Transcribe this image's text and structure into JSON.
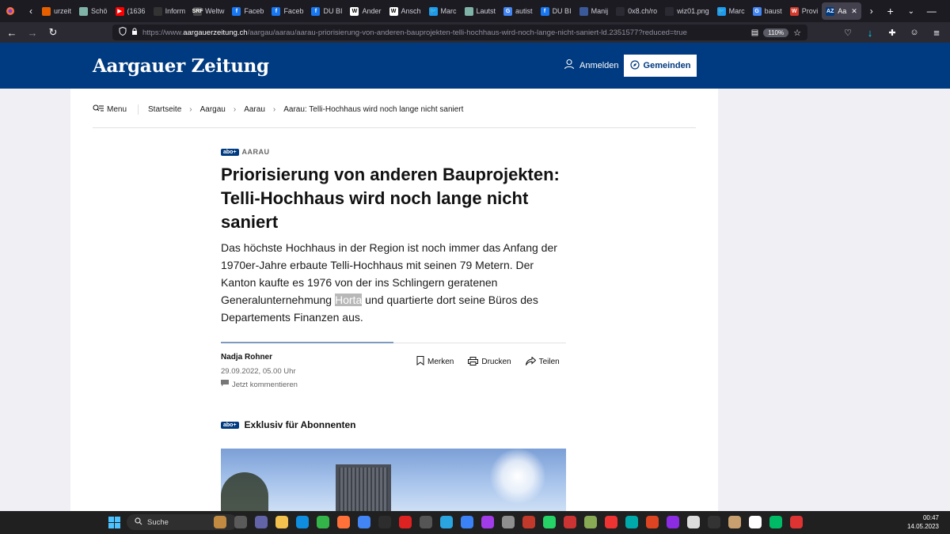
{
  "browser": {
    "tabs": [
      {
        "label": "urzeit",
        "color": "#e66000",
        "favtext": ""
      },
      {
        "label": "Schö",
        "color": "#7fb3a7",
        "favtext": ""
      },
      {
        "label": "(1636",
        "color": "#ff0000",
        "favtext": "▶"
      },
      {
        "label": "Inform",
        "color": "#333333",
        "favtext": ""
      },
      {
        "label": "Weltw",
        "color": "#444444",
        "favtext": "SRF"
      },
      {
        "label": "Faceb",
        "color": "#1877f2",
        "favtext": "f"
      },
      {
        "label": "Faceb",
        "color": "#1877f2",
        "favtext": "f"
      },
      {
        "label": "DU BI",
        "color": "#1877f2",
        "favtext": "f"
      },
      {
        "label": "Ander",
        "color": "#ffffff",
        "favtext": "W"
      },
      {
        "label": "Ansch",
        "color": "#ffffff",
        "favtext": "W"
      },
      {
        "label": "Marc",
        "color": "#1d9bf0",
        "favtext": "🐦"
      },
      {
        "label": "Lautst",
        "color": "#7fb3a7",
        "favtext": ""
      },
      {
        "label": "autist",
        "color": "#4285f4",
        "favtext": "G"
      },
      {
        "label": "DU BI",
        "color": "#1877f2",
        "favtext": "f"
      },
      {
        "label": "Manij",
        "color": "#3b5998",
        "favtext": ""
      },
      {
        "label": "0x8.ch/ro",
        "color": "#2b2a33",
        "favtext": ""
      },
      {
        "label": "wiz01.png",
        "color": "#2b2a33",
        "favtext": ""
      },
      {
        "label": "Marc",
        "color": "#1d9bf0",
        "favtext": "🐦"
      },
      {
        "label": "baust",
        "color": "#4285f4",
        "favtext": "G"
      },
      {
        "label": "Provi",
        "color": "#d33a2c",
        "favtext": "W"
      },
      {
        "label": "Aa",
        "color": "#003a80",
        "favtext": "AZ",
        "active": true
      }
    ],
    "url_prefix": "https://www.",
    "url_host": "aargauerzeitung.ch",
    "url_path": "/aargau/aarau/aarau-priorisierung-von-anderen-bauprojekten-telli-hochhaus-wird-noch-lange-nicht-saniert-ld.2351577?reduced=true",
    "zoom": "110%"
  },
  "site": {
    "logo": "Aargauer Zeitung",
    "login_label": "Anmelden",
    "gemeinden_label": "Gemeinden"
  },
  "breadcrumb": {
    "menu_label": "Menu",
    "items": [
      "Startseite",
      "Aargau",
      "Aarau",
      "Aarau: Telli-Hochhaus wird noch lange nicht saniert"
    ]
  },
  "article": {
    "abo_badge": "abo+",
    "kicker": "AARAU",
    "headline": "Priorisierung von anderen Bauprojekten: Telli-Hochhaus wird noch lange nicht saniert",
    "lead_before": "Das höchste Hochhaus in der Region ist noch immer das Anfang der 1970er-Jahre erbaute Telli-Hochhaus mit seinen 79 Metern. Der Kanton kaufte es 1976 von der ins Schlingern geratenen Generalunternehmung ",
    "lead_highlight": "Horta",
    "lead_after": " und quartierte dort seine Büros des Departements Finanzen aus.",
    "author": "Nadja Rohner",
    "date": "29.09.2022, 05.00 Uhr",
    "comment_label": "Jetzt kommentieren",
    "actions": {
      "merken": "Merken",
      "drucken": "Drucken",
      "teilen": "Teilen"
    },
    "exklusiv_label": "Exklusiv für Abonnenten"
  },
  "taskbar": {
    "search_label": "Suche",
    "time": "00:47",
    "date": "14.05.2023"
  }
}
